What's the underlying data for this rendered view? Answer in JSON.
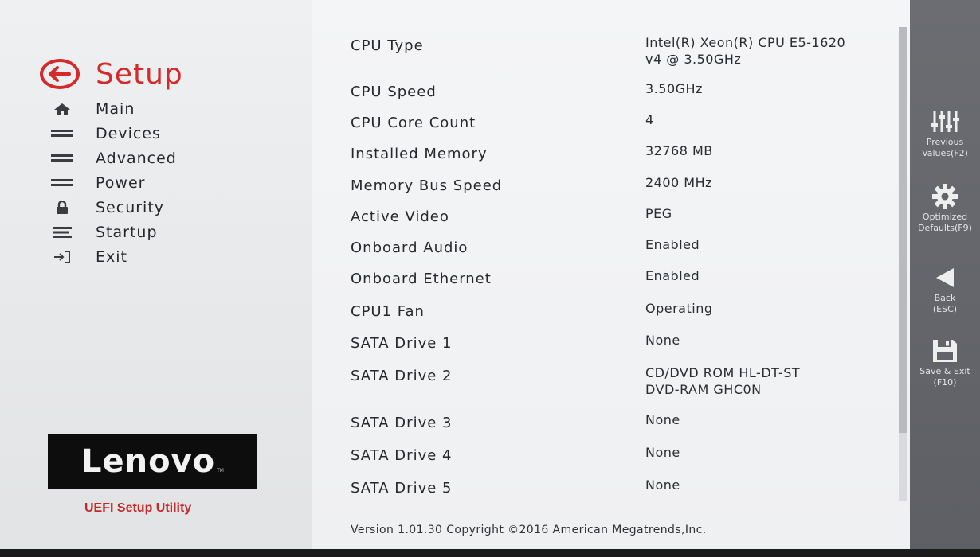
{
  "header": {
    "title": "Setup"
  },
  "nav": {
    "items": [
      {
        "label": "Main",
        "icon": "home-icon"
      },
      {
        "label": "Devices",
        "icon": "devices-icon"
      },
      {
        "label": "Advanced",
        "icon": "advanced-icon"
      },
      {
        "label": "Power",
        "icon": "power-icon"
      },
      {
        "label": "Security",
        "icon": "lock-icon"
      },
      {
        "label": "Startup",
        "icon": "startup-icon"
      },
      {
        "label": "Exit",
        "icon": "exit-icon"
      }
    ]
  },
  "brand": {
    "logo": "Lenovo",
    "utility": "UEFI Setup Utility"
  },
  "info": {
    "rows": [
      {
        "label": "CPU Type",
        "value": "Intel(R) Xeon(R) CPU E5-1620\nv4 @ 3.50GHz"
      },
      {
        "label": "CPU Speed",
        "value": "3.50GHz"
      },
      {
        "label": "CPU Core Count",
        "value": "4"
      },
      {
        "label": "Installed Memory",
        "value": "32768 MB"
      },
      {
        "label": "Memory Bus Speed",
        "value": "2400 MHz"
      },
      {
        "label": "Active Video",
        "value": "PEG"
      },
      {
        "label": "Onboard Audio",
        "value": "Enabled"
      },
      {
        "label": "Onboard Ethernet",
        "value": "Enabled"
      },
      {
        "label": "CPU1 Fan",
        "value": "Operating"
      },
      {
        "label": "SATA Drive 1",
        "value": "None"
      },
      {
        "label": "SATA Drive 2",
        "value": "CD/DVD ROM HL-DT-ST\nDVD-RAM GHC0N"
      },
      {
        "label": "SATA Drive 3",
        "value": "None"
      },
      {
        "label": "SATA Drive 4",
        "value": "None"
      },
      {
        "label": "SATA Drive 5",
        "value": "None"
      }
    ]
  },
  "footer": {
    "version": "Version 1.01.30 Copyright ©2016 American Megatrends,Inc."
  },
  "actions": [
    {
      "label": "Previous\nValues(F2)",
      "icon": "sliders-icon"
    },
    {
      "label": "Optimized\nDefaults(F9)",
      "icon": "gear-icon"
    },
    {
      "label": "Back\n(ESC)",
      "icon": "back-arrow-icon"
    },
    {
      "label": "Save & Exit\n(F10)",
      "icon": "save-icon"
    }
  ],
  "colors": {
    "accent": "#d42a2a",
    "sidebar": "#5e5f64",
    "logo_bg": "#0d0d0e"
  }
}
